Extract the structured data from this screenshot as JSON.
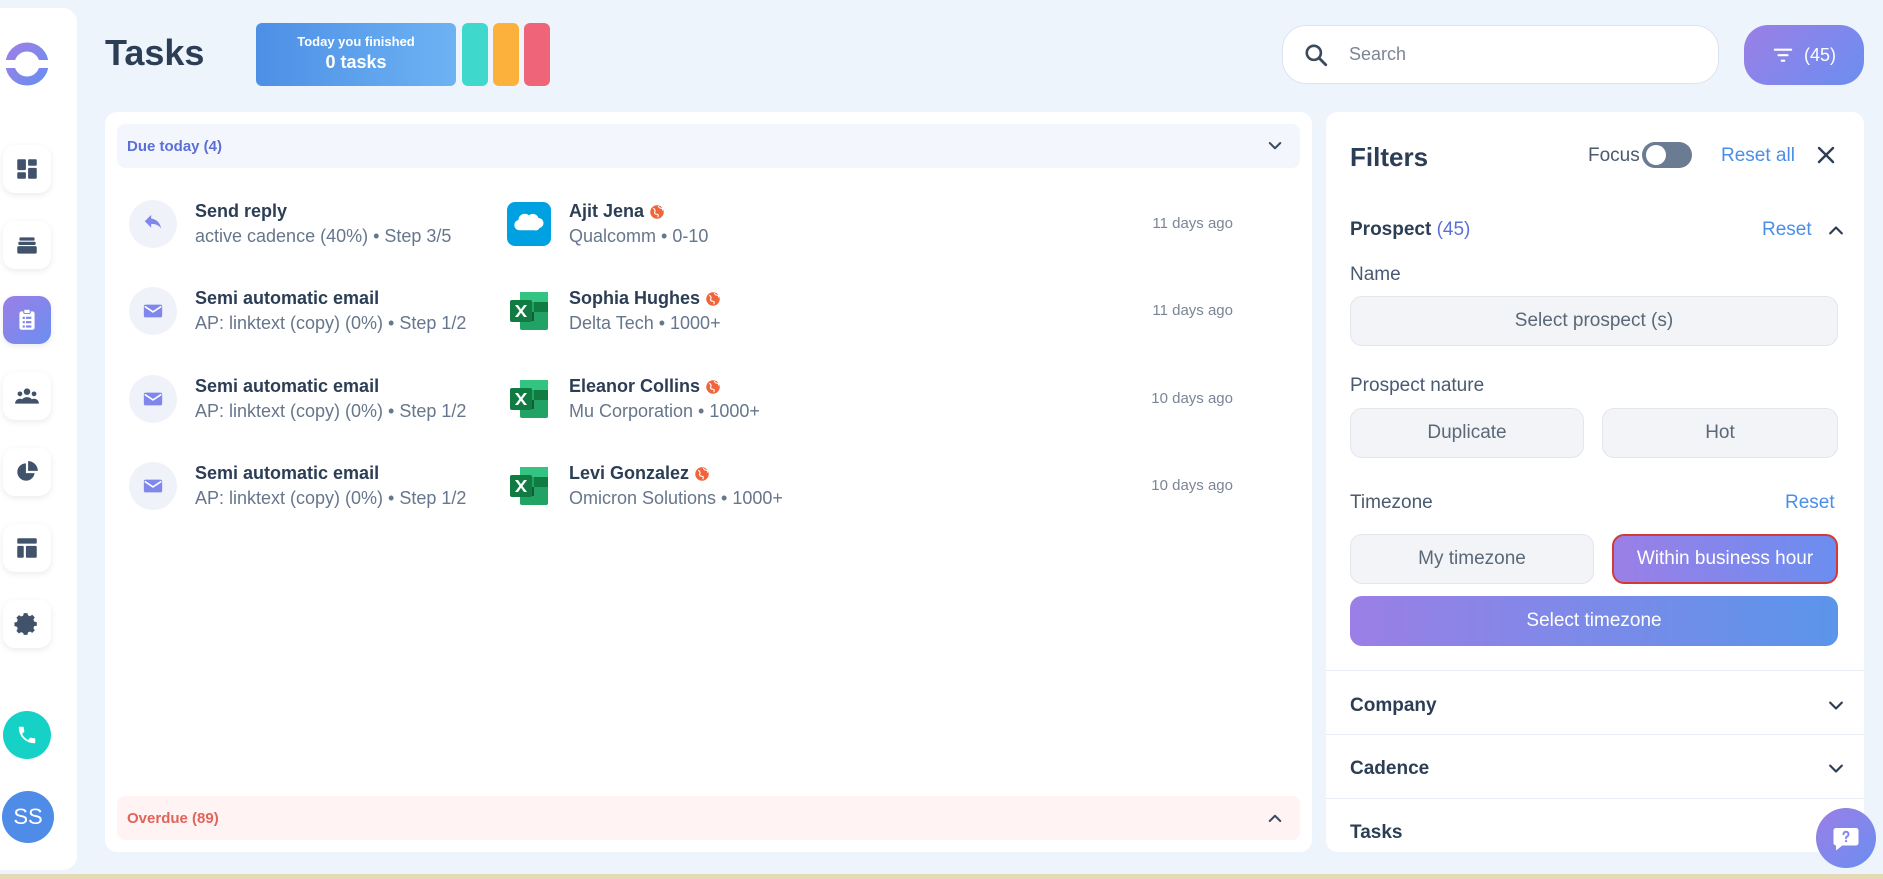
{
  "header": {
    "title": "Tasks",
    "finished_line1": "Today you finished",
    "finished_line2": "0 tasks",
    "search_placeholder": "Search",
    "filter_count": "(45)"
  },
  "sidebar": {
    "items": [
      "dashboard",
      "inbox",
      "tasks",
      "prospects",
      "reports",
      "templates",
      "settings"
    ],
    "active": "tasks",
    "avatar_initials": "SS"
  },
  "colors": {
    "accent_purple": "#9b7fe6",
    "accent_blue": "#6b8ef0",
    "pill_teal": "#3ed8cc",
    "pill_orange": "#fbb13c",
    "pill_pink": "#f0647a",
    "call_green": "#16d1c6"
  },
  "groups": {
    "due_today": "Due today (4)",
    "overdue": "Overdue (89)"
  },
  "tasks": [
    {
      "icon": "reply-icon",
      "title": "Send reply",
      "sub": "active cadence (40%) • Step 3/5",
      "crm": "salesforce",
      "name": "Ajit Jena",
      "company": "Qualcomm • 0-10",
      "time": "11 days ago"
    },
    {
      "icon": "mail-icon",
      "title": "Semi automatic email",
      "sub": "AP: linktext (copy) (0%) • Step 1/2",
      "crm": "excel",
      "name": "Sophia Hughes",
      "company": "Delta Tech • 1000+",
      "time": "11 days ago"
    },
    {
      "icon": "mail-icon",
      "title": "Semi automatic email",
      "sub": "AP: linktext (copy) (0%) • Step 1/2",
      "crm": "excel",
      "name": "Eleanor Collins",
      "company": "Mu Corporation • 1000+",
      "time": "10 days ago"
    },
    {
      "icon": "mail-icon",
      "title": "Semi automatic email",
      "sub": "AP: linktext (copy) (0%) • Step 1/2",
      "crm": "excel",
      "name": "Levi Gonzalez",
      "company": "Omicron Solutions • 1000+",
      "time": "10 days ago"
    }
  ],
  "filters": {
    "title": "Filters",
    "focus_label": "Focus",
    "reset_all": "Reset all",
    "prospect_label": "Prospect",
    "prospect_count": "(45)",
    "reset": "Reset",
    "name_label": "Name",
    "select_prospect": "Select prospect (s)",
    "nature_label": "Prospect nature",
    "nature_options": [
      "Duplicate",
      "Hot"
    ],
    "timezone_label": "Timezone",
    "my_timezone": "My timezone",
    "within_business": "Within business hour",
    "select_timezone": "Select timezone",
    "company": "Company",
    "cadence": "Cadence",
    "tasks": "Tasks"
  }
}
